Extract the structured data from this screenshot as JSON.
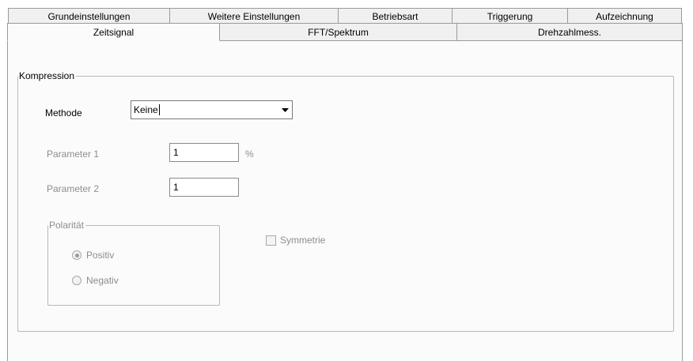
{
  "tabs_back": [
    {
      "label": "Grundeinstellungen"
    },
    {
      "label": "Weitere Einstellungen"
    },
    {
      "label": "Betriebsart"
    },
    {
      "label": "Triggerung"
    },
    {
      "label": "Aufzeichnung"
    }
  ],
  "tabs_front": [
    {
      "label": "Zeitsignal",
      "selected": true
    },
    {
      "label": "FFT/Spektrum"
    },
    {
      "label": "Drehzahlmess."
    }
  ],
  "compression": {
    "group_title": "Kompression",
    "method_label": "Methode",
    "method_value": "Keine",
    "param1_label": "Parameter 1",
    "param1_value": "1",
    "param1_unit": "%",
    "param2_label": "Parameter 2",
    "param2_value": "1",
    "polarity": {
      "title": "Polarität",
      "options": [
        {
          "label": "Positiv",
          "checked": true
        },
        {
          "label": "Negativ",
          "checked": false
        }
      ]
    },
    "symmetry_label": "Symmetrie",
    "symmetry_checked": false
  },
  "colors": {
    "tab_bg": "#f0f0f0",
    "panel_bg": "#fbfbfb",
    "disabled_text": "#8d8d8d"
  }
}
